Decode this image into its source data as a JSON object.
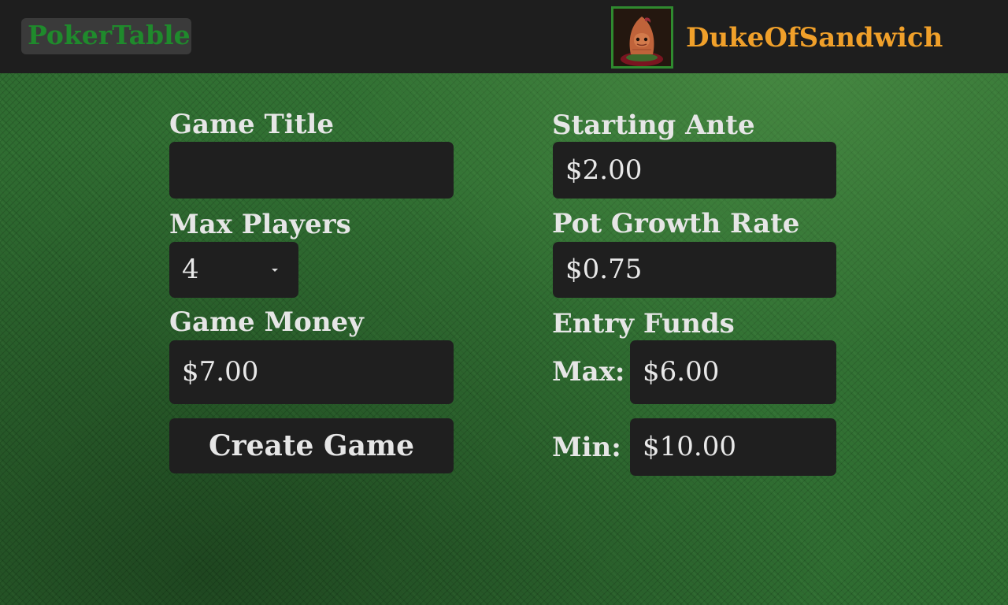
{
  "header": {
    "app_title": "PokerTable",
    "username": "DukeOfSandwich",
    "avatar_icon": "hooded-figure-avatar-icon"
  },
  "colors": {
    "header_bg": "#1e1e1e",
    "felt_green": "#2f6d31",
    "logo_text": "#1f8a2c",
    "username_text": "#f0a02a",
    "field_bg": "#1f1f1f",
    "label_text": "#e6e6e6"
  },
  "form": {
    "game_title": {
      "label": "Game Title",
      "value": ""
    },
    "max_players": {
      "label": "Max Players",
      "value": "4"
    },
    "game_money": {
      "label": "Game Money",
      "value": "$7.00"
    },
    "create_button": "Create Game",
    "starting_ante": {
      "label": "Starting Ante",
      "value": "$2.00"
    },
    "pot_growth_rate": {
      "label": "Pot Growth Rate",
      "value": "$0.75"
    },
    "entry_funds": {
      "label": "Entry Funds",
      "max_label": "Max:",
      "max_value": "$6.00",
      "min_label": "Min:",
      "min_value": "$10.00"
    }
  }
}
